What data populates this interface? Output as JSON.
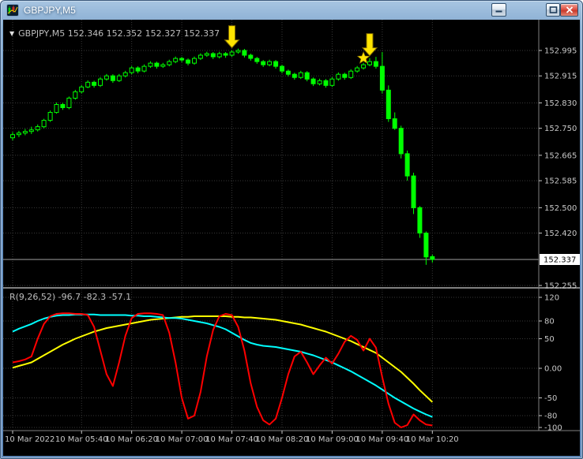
{
  "window": {
    "title": "GBPJPY,M5"
  },
  "icons": {
    "one_click_trading": "▼"
  },
  "main_chart": {
    "ohlc_label": "GBPJPY,M5 152.346 152.352 152.327 152.337",
    "current_price": "152.337"
  },
  "indicator_panel": {
    "label": "R(9,26,52) -96.7 -82.3 -57.1"
  },
  "colors": {
    "background": "#000000",
    "grid": "#383838",
    "candle": "#00FF00",
    "candle_up_fill": "#000000",
    "axis_text": "#C8C8C8",
    "separator": "#808080",
    "bid_line": "#A0A0A0",
    "price_tag_bg": "#FFFFFF",
    "price_tag_text": "#000000",
    "signal": "#FFE400",
    "signal_outline": "#806A00"
  },
  "chart_data": [
    {
      "type": "candlestick",
      "symbol": "GBPJPY",
      "timeframe": "M5",
      "start_time": "10 Mar 2022 04:45",
      "interval_minutes": 5,
      "ylim": [
        152.255,
        153.02
      ],
      "price_ticks": [
        "152.995",
        "152.915",
        "152.830",
        "152.750",
        "152.665",
        "152.585",
        "152.500",
        "152.420",
        "152.255"
      ],
      "candles": [
        [
          152.72,
          152.738,
          152.712,
          152.73
        ],
        [
          152.73,
          152.742,
          152.722,
          152.735
        ],
        [
          152.735,
          152.748,
          152.728,
          152.74
        ],
        [
          152.74,
          152.755,
          152.732,
          152.745
        ],
        [
          152.745,
          152.762,
          152.74,
          152.755
        ],
        [
          152.755,
          152.78,
          152.75,
          152.775
        ],
        [
          152.775,
          152.806,
          152.77,
          152.8
        ],
        [
          152.8,
          152.831,
          152.796,
          152.825
        ],
        [
          152.825,
          152.83,
          152.808,
          152.815
        ],
        [
          152.815,
          152.85,
          152.81,
          152.845
        ],
        [
          152.845,
          152.871,
          152.84,
          152.865
        ],
        [
          152.865,
          152.886,
          152.86,
          152.88
        ],
        [
          152.88,
          152.901,
          152.876,
          152.895
        ],
        [
          152.895,
          152.9,
          152.878,
          152.885
        ],
        [
          152.885,
          152.911,
          152.88,
          152.905
        ],
        [
          152.905,
          152.921,
          152.9,
          152.915
        ],
        [
          152.915,
          152.92,
          152.893,
          152.9
        ],
        [
          152.9,
          152.921,
          152.896,
          152.915
        ],
        [
          152.915,
          152.931,
          152.91,
          152.925
        ],
        [
          152.925,
          152.946,
          152.92,
          152.94
        ],
        [
          152.94,
          152.945,
          152.923,
          152.93
        ],
        [
          152.93,
          152.951,
          152.926,
          152.945
        ],
        [
          152.945,
          152.961,
          152.94,
          152.955
        ],
        [
          152.955,
          152.96,
          152.938,
          152.945
        ],
        [
          152.945,
          152.956,
          152.94,
          152.95
        ],
        [
          152.95,
          152.966,
          152.945,
          152.96
        ],
        [
          152.96,
          152.976,
          152.955,
          152.97
        ],
        [
          152.97,
          152.975,
          152.958,
          152.965
        ],
        [
          152.965,
          152.97,
          152.948,
          152.955
        ],
        [
          152.955,
          152.976,
          152.95,
          152.97
        ],
        [
          152.97,
          152.986,
          152.965,
          152.98
        ],
        [
          152.98,
          152.991,
          152.975,
          152.985
        ],
        [
          152.985,
          152.99,
          152.968,
          152.975
        ],
        [
          152.975,
          152.991,
          152.97,
          152.985
        ],
        [
          152.985,
          152.99,
          152.972,
          152.98
        ],
        [
          152.98,
          152.996,
          152.975,
          152.99
        ],
        [
          152.99,
          153.001,
          152.985,
          152.995
        ],
        [
          152.995,
          153.0,
          152.973,
          152.98
        ],
        [
          152.98,
          152.985,
          152.963,
          152.97
        ],
        [
          152.97,
          152.975,
          152.953,
          152.96
        ],
        [
          152.96,
          152.965,
          152.943,
          152.95
        ],
        [
          152.95,
          152.966,
          152.945,
          152.96
        ],
        [
          152.96,
          152.965,
          152.938,
          152.945
        ],
        [
          152.945,
          152.95,
          152.923,
          152.93
        ],
        [
          152.93,
          152.935,
          152.913,
          152.92
        ],
        [
          152.92,
          152.925,
          152.903,
          152.91
        ],
        [
          152.91,
          152.931,
          152.905,
          152.925
        ],
        [
          152.925,
          152.93,
          152.898,
          152.905
        ],
        [
          152.905,
          152.91,
          152.883,
          152.89
        ],
        [
          152.89,
          152.906,
          152.885,
          152.9
        ],
        [
          152.9,
          152.905,
          152.878,
          152.885
        ],
        [
          152.885,
          152.911,
          152.88,
          152.905
        ],
        [
          152.905,
          152.926,
          152.9,
          152.92
        ],
        [
          152.92,
          152.925,
          152.903,
          152.91
        ],
        [
          152.91,
          152.936,
          152.905,
          152.93
        ],
        [
          152.93,
          152.946,
          152.925,
          152.94
        ],
        [
          152.94,
          152.956,
          152.935,
          152.95
        ],
        [
          152.95,
          152.971,
          152.945,
          152.96
        ],
        [
          152.96,
          152.975,
          152.938,
          152.945
        ],
        [
          152.945,
          152.99,
          152.86,
          152.87
        ],
        [
          152.87,
          152.885,
          152.77,
          152.78
        ],
        [
          152.78,
          152.8,
          152.745,
          152.75
        ],
        [
          152.75,
          152.758,
          152.655,
          152.67
        ],
        [
          152.67,
          152.68,
          152.585,
          152.6
        ],
        [
          152.6,
          152.61,
          152.48,
          152.5
        ],
        [
          152.5,
          152.505,
          152.405,
          152.42
        ],
        [
          152.42,
          152.425,
          152.32,
          152.345
        ],
        [
          152.346,
          152.352,
          152.327,
          152.337
        ]
      ],
      "signals": [
        {
          "type": "arrow-down",
          "candle_index": 35
        },
        {
          "type": "star",
          "candle_index": 56
        },
        {
          "type": "arrow-down",
          "candle_index": 57
        }
      ],
      "time_axis": [
        {
          "text": "10 Mar 2022",
          "candle_index": 0
        },
        {
          "text": "10 Mar 05:40",
          "candle_index": 11
        },
        {
          "text": "10 Mar 06:20",
          "candle_index": 19
        },
        {
          "text": "10 Mar 07:00",
          "candle_index": 27
        },
        {
          "text": "10 Mar 07:40",
          "candle_index": 35
        },
        {
          "text": "10 Mar 08:20",
          "candle_index": 43
        },
        {
          "text": "10 Mar 09:00",
          "candle_index": 51
        },
        {
          "text": "10 Mar 09:40",
          "candle_index": 59
        },
        {
          "text": "10 Mar 10:20",
          "candle_index": 67
        }
      ]
    },
    {
      "type": "line",
      "title": "R(9,26,52)",
      "current_values": [
        -96.7,
        -82.3,
        -57.1
      ],
      "ylim": [
        -100,
        120
      ],
      "yticks": [
        "120",
        "80",
        "50",
        "0.00",
        "-50",
        "-80",
        "-100"
      ],
      "legend_position": "none",
      "series": [
        {
          "name": "r9",
          "color": "#FF0000",
          "values": [
            10,
            12,
            15,
            20,
            50,
            75,
            88,
            92,
            93,
            93,
            92,
            92,
            90,
            70,
            30,
            -10,
            -30,
            10,
            55,
            85,
            92,
            93,
            93,
            92,
            90,
            60,
            10,
            -50,
            -85,
            -80,
            -40,
            20,
            65,
            88,
            92,
            90,
            70,
            30,
            -25,
            -65,
            -88,
            -95,
            -85,
            -50,
            -10,
            20,
            28,
            10,
            -10,
            5,
            18,
            8,
            25,
            45,
            55,
            48,
            30,
            50,
            35,
            -15,
            -60,
            -92,
            -100,
            -96,
            -78,
            -88,
            -95,
            -96.7
          ]
        },
        {
          "name": "r26",
          "color": "#00FFFF",
          "values": [
            62,
            67,
            71,
            75,
            80,
            84,
            87,
            89,
            90,
            90,
            91,
            91,
            91,
            91,
            90,
            90,
            90,
            90,
            90,
            89,
            89,
            88,
            88,
            87,
            86,
            85,
            85,
            84,
            82,
            80,
            78,
            76,
            73,
            70,
            66,
            60,
            54,
            48,
            43,
            40,
            38,
            37,
            36,
            34,
            32,
            30,
            28,
            25,
            22,
            18,
            14,
            10,
            5,
            0,
            -5,
            -11,
            -17,
            -23,
            -29,
            -36,
            -43,
            -50,
            -56,
            -62,
            -68,
            -73,
            -78,
            -82.3
          ]
        },
        {
          "name": "r52",
          "color": "#FFFF00",
          "values": [
            1,
            4,
            7,
            10,
            16,
            22,
            28,
            34,
            40,
            45,
            50,
            54,
            58,
            62,
            65,
            68,
            70,
            72,
            74,
            76,
            78,
            80,
            82,
            83,
            84,
            85,
            86,
            87,
            87,
            88,
            88,
            88,
            88,
            88,
            88,
            87,
            87,
            86,
            86,
            85,
            84,
            83,
            82,
            80,
            78,
            76,
            74,
            71,
            68,
            65,
            62,
            58,
            54,
            50,
            46,
            41,
            36,
            31,
            26,
            18,
            10,
            2,
            -6,
            -16,
            -26,
            -37,
            -47,
            -57.1
          ]
        }
      ]
    }
  ]
}
